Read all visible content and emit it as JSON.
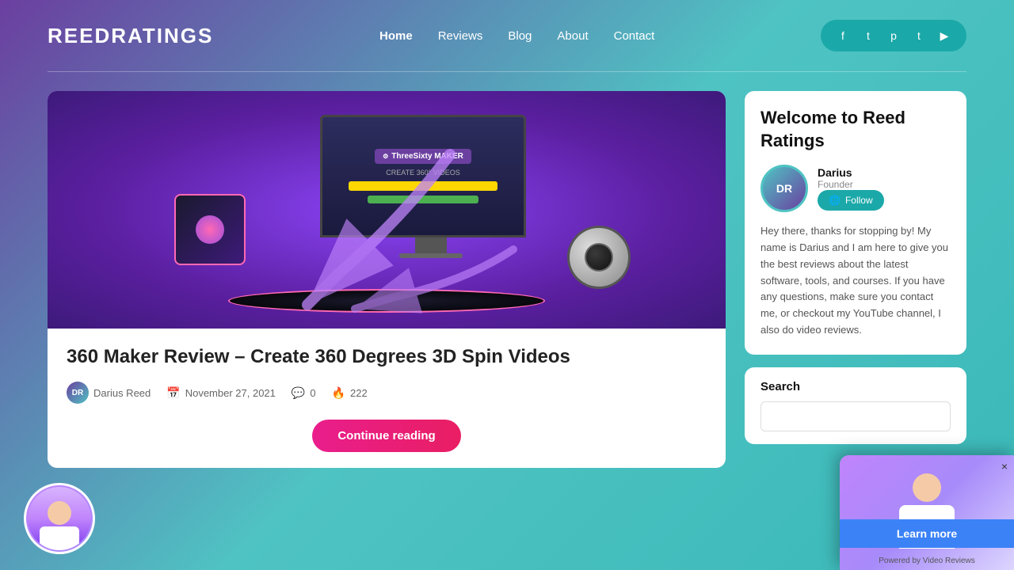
{
  "header": {
    "logo": "ReedRatings",
    "nav": {
      "items": [
        {
          "label": "Home",
          "active": true
        },
        {
          "label": "Reviews",
          "active": false
        },
        {
          "label": "Blog",
          "active": false
        },
        {
          "label": "About",
          "active": false
        },
        {
          "label": "Contact",
          "active": false
        }
      ]
    },
    "social_icons": [
      "f",
      "t",
      "p",
      "t",
      "y"
    ]
  },
  "article": {
    "title": "360 Maker Review – Create 360 Degrees 3D Spin Videos",
    "author": "Darius Reed",
    "date": "November 27, 2021",
    "comments": "0",
    "views": "222",
    "continue_btn": "Continue reading"
  },
  "sidebar": {
    "welcome_title": "Welcome to Reed Ratings",
    "author_name": "Darius",
    "author_role": "Founder",
    "author_bio": "Hey there, thanks for stopping by! My name is Darius and I am here to give you the best reviews about the latest software, tools, and courses. If you have any questions, make sure you contact me, or checkout my YouTube channel, I also do video reviews.",
    "follow_btn": "Follow",
    "search_label": "Search",
    "search_placeholder": ""
  },
  "video_overlay": {
    "learn_more_label": "Learn more",
    "powered_by": "Powered by Video Reviews",
    "close_icon": "×"
  },
  "icons": {
    "facebook": "f",
    "twitter": "t",
    "pinterest": "p",
    "tumblr": "t",
    "youtube": "▶",
    "comment": "💬",
    "fire": "🔥",
    "calendar": "📅",
    "user": "👤",
    "globe": "🌐"
  }
}
